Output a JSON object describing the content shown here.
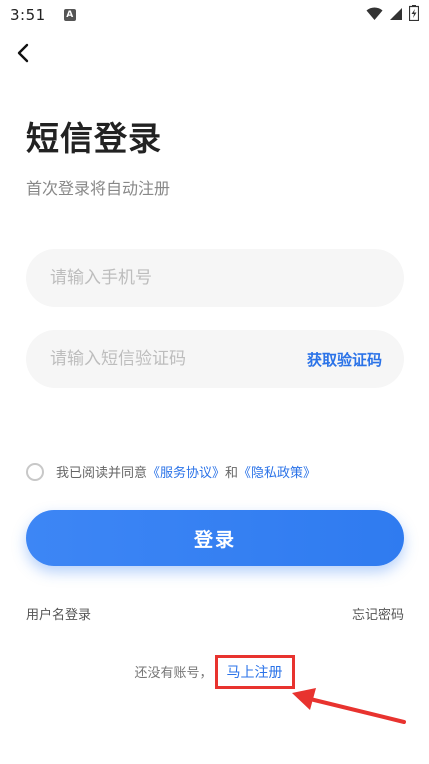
{
  "status_bar": {
    "time": "3:51",
    "notification_icon": "A"
  },
  "header": {
    "title": "短信登录",
    "subtitle": "首次登录将自动注册"
  },
  "form": {
    "phone_placeholder": "请输入手机号",
    "code_placeholder": "请输入短信验证码",
    "get_code_label": "获取验证码"
  },
  "agreement": {
    "prefix": "我已阅读并同意",
    "service_link": "《服务协议》",
    "and": "和",
    "privacy_link": "《隐私政策》"
  },
  "login_button": "登录",
  "alt_links": {
    "username_login": "用户名登录",
    "forgot_password": "忘记密码"
  },
  "register": {
    "prompt": "还没有账号，",
    "link": "马上注册"
  },
  "colors": {
    "accent": "#2b73e8",
    "annotation": "#e8332f"
  }
}
